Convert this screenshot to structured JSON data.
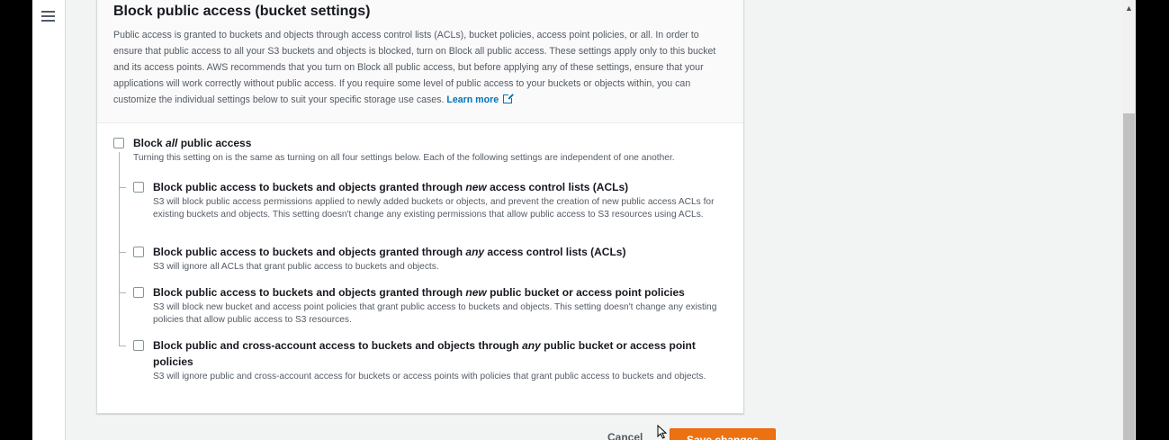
{
  "panel": {
    "title": "Block public access (bucket settings)",
    "description": "Public access is granted to buckets and objects through access control lists (ACLs), bucket policies, access point policies, or all. In order to ensure that public access to all your S3 buckets and objects is blocked, turn on Block all public access. These settings apply only to this bucket and its access points. AWS recommends that you turn on Block all public access, but before applying any of these settings, ensure that your applications will work correctly without public access. If you require some level of public access to your buckets or objects within, you can customize the individual settings below to suit your specific storage use cases.",
    "learn_more": "Learn more"
  },
  "block_all": {
    "title_prefix": "Block ",
    "title_em": "all",
    "title_suffix": " public access",
    "description": "Turning this setting on is the same as turning on all four settings below. Each of the following settings are independent of one another.",
    "checked": false
  },
  "settings": [
    {
      "title_prefix": "Block public access to buckets and objects granted through ",
      "title_em": "new",
      "title_suffix": " access control lists (ACLs)",
      "description": "S3 will block public access permissions applied to newly added buckets or objects, and prevent the creation of new public access ACLs for existing buckets and objects. This setting doesn't change any existing permissions that allow public access to S3 resources using ACLs.",
      "checked": false
    },
    {
      "title_prefix": "Block public access to buckets and objects granted through ",
      "title_em": "any",
      "title_suffix": " access control lists (ACLs)",
      "description": "S3 will ignore all ACLs that grant public access to buckets and objects.",
      "checked": false
    },
    {
      "title_prefix": "Block public access to buckets and objects granted through ",
      "title_em": "new",
      "title_suffix": " public bucket or access point policies",
      "description": "S3 will block new bucket and access point policies that grant public access to buckets and objects. This setting doesn't change any existing policies that allow public access to S3 resources.",
      "checked": false
    },
    {
      "title_prefix": "Block public and cross-account access to buckets and objects through ",
      "title_em": "any",
      "title_suffix": " public bucket or access point policies",
      "description": "S3 will ignore public and cross-account access for buckets or access points with policies that grant public access to buckets and objects.",
      "checked": false
    }
  ],
  "footer": {
    "cancel_label": "Cancel",
    "save_label": "Save changes"
  },
  "icons": {
    "menu": "hamburger-menu-icon",
    "external": "external-link-icon",
    "scroll_up": "scroll-up-arrow-icon",
    "cursor": "mouse-pointer-icon"
  },
  "colors": {
    "accent_button": "#ec7211",
    "link": "#0073bb",
    "text": "#16191f",
    "muted_text": "#545b64"
  }
}
